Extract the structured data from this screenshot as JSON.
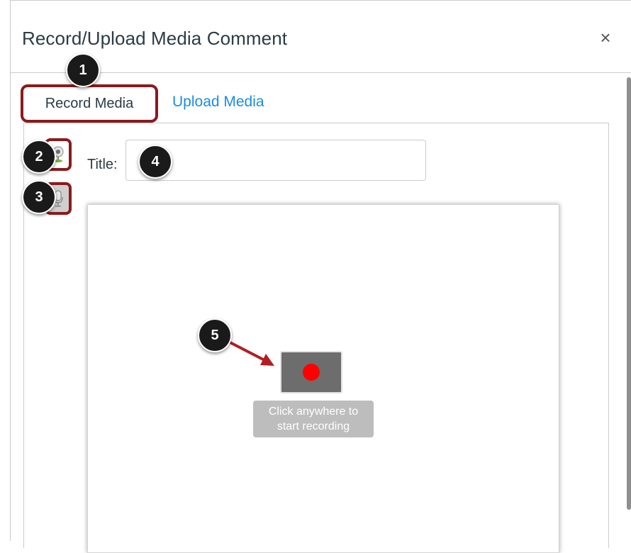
{
  "dialog": {
    "title": "Record/Upload Media Comment",
    "close_symbol": "×"
  },
  "tabs": [
    {
      "label": "Record Media",
      "selected": true
    },
    {
      "label": "Upload Media",
      "selected": false
    }
  ],
  "form": {
    "title_label": "Title:",
    "title_value": ""
  },
  "recorder": {
    "hint_line1": "Click anywhere to",
    "hint_line2": "start recording",
    "record_icon": "record-dot-icon",
    "record_color": "#ff0000"
  },
  "icons": {
    "webcam": "webcam-icon",
    "microphone": "microphone-icon"
  },
  "callouts": [
    "1",
    "2",
    "3",
    "4",
    "5"
  ],
  "colors": {
    "highlight_border": "#8b1a1d",
    "link_blue": "#1b8ce3",
    "callout_bg": "#1a1a1a"
  }
}
